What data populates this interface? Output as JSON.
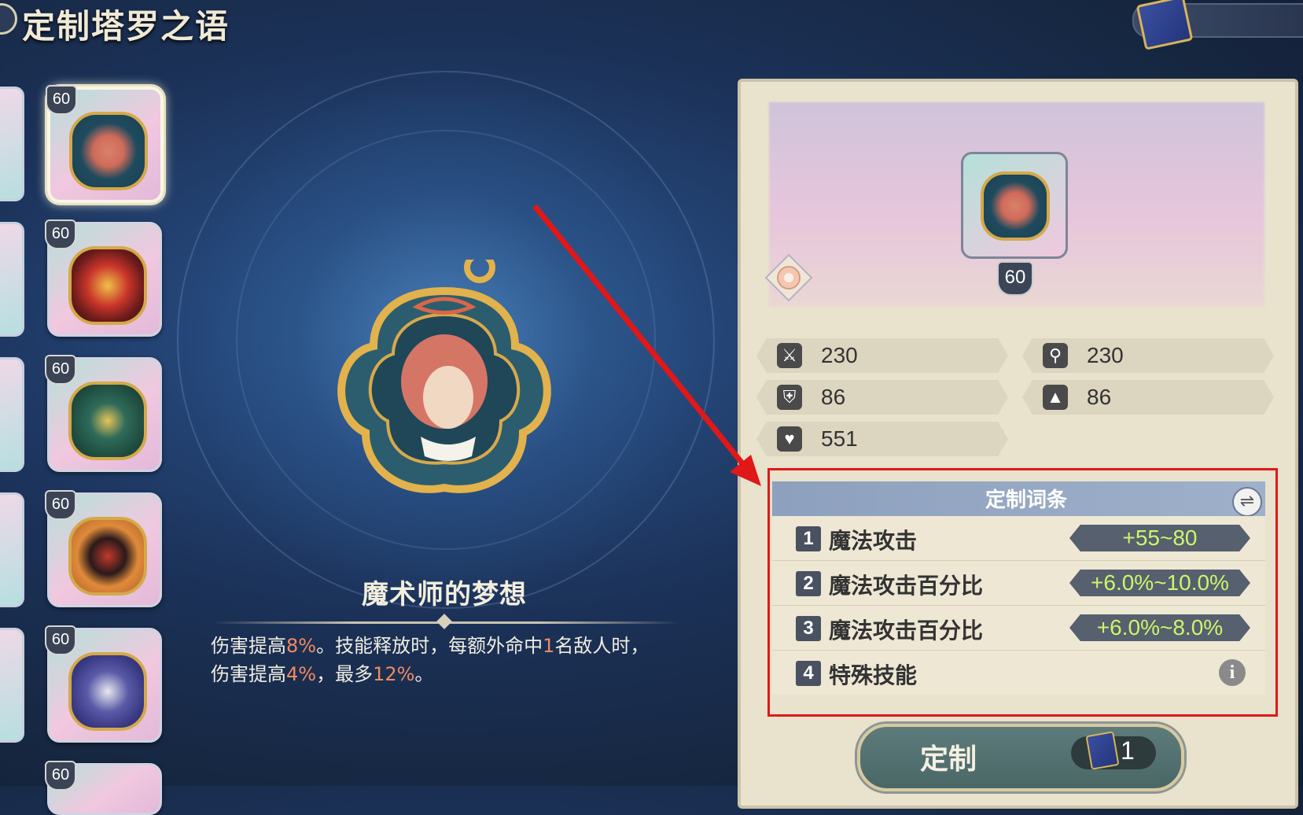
{
  "header": {
    "title": "定制塔罗之语"
  },
  "card_list": [
    {
      "level": "60",
      "selected": true,
      "theme": "sleeping-girl"
    },
    {
      "level": "60",
      "selected": false,
      "theme": "crown"
    },
    {
      "level": "60",
      "selected": false,
      "theme": "clover-cross"
    },
    {
      "level": "60",
      "selected": false,
      "theme": "wheel"
    },
    {
      "level": "60",
      "selected": false,
      "theme": "hooded-sage"
    },
    {
      "level": "60",
      "selected": false,
      "theme": "partial"
    }
  ],
  "item": {
    "name": "魔术师的梦想",
    "desc_parts": [
      "伤害提高",
      "8%",
      "。技能释放时，每额外命中",
      "1",
      "名敌人时，",
      "伤害提高",
      "4%",
      "，最多",
      "12%",
      "。"
    ]
  },
  "panel": {
    "level": "60",
    "stats": [
      {
        "icon": "sword-icon",
        "value": "230"
      },
      {
        "icon": "wand-icon",
        "value": "230"
      },
      {
        "icon": "shield-icon",
        "value": "86"
      },
      {
        "icon": "wizard-hat-icon",
        "value": "86"
      },
      {
        "icon": "heart-icon",
        "value": "551"
      }
    ],
    "affix_title": "定制词条",
    "affixes": [
      {
        "num": "1",
        "label": "魔法攻击",
        "range": "+55~80"
      },
      {
        "num": "2",
        "label": "魔法攻击百分比",
        "range": "+6.0%~10.0%"
      },
      {
        "num": "3",
        "label": "魔法攻击百分比",
        "range": "+6.0%~8.0%"
      },
      {
        "num": "4",
        "label": "特殊技能",
        "range": ""
      }
    ],
    "button_label": "定制",
    "cost": "1"
  },
  "colors": {
    "highlight": "#f08a62",
    "range_text": "#cdf56c",
    "annotation_red": "#e01818"
  }
}
